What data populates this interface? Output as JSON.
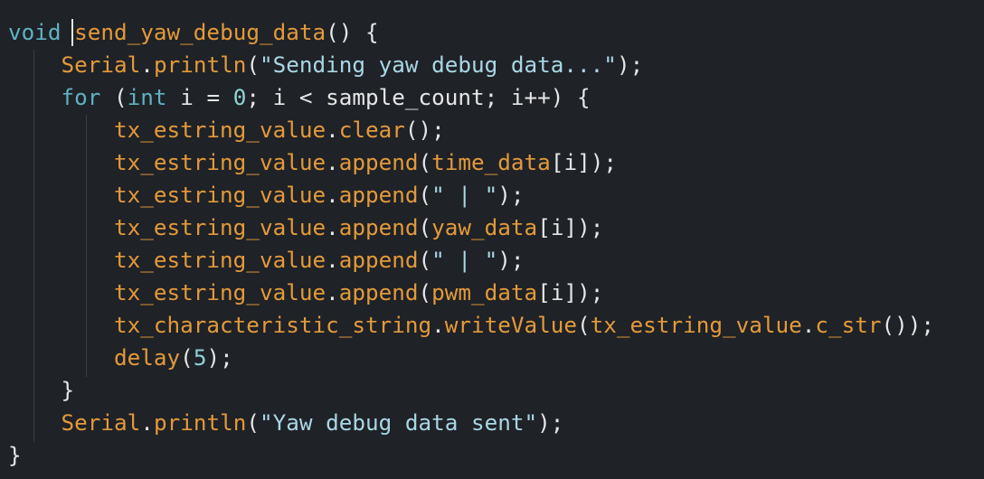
{
  "editor": {
    "lines": [
      [
        {
          "t": "void",
          "c": "kw"
        },
        {
          "t": " ",
          "c": "pun"
        },
        {
          "t": "send_yaw_debug_data",
          "c": "fn"
        },
        {
          "t": "() {",
          "c": "pun"
        }
      ],
      [
        {
          "t": "    ",
          "c": "pun"
        },
        {
          "t": "Serial",
          "c": "id"
        },
        {
          "t": ".",
          "c": "pun"
        },
        {
          "t": "println",
          "c": "fn"
        },
        {
          "t": "(",
          "c": "pun"
        },
        {
          "t": "\"Sending yaw debug data...\"",
          "c": "str"
        },
        {
          "t": ");",
          "c": "pun"
        }
      ],
      [
        {
          "t": "    ",
          "c": "pun"
        },
        {
          "t": "for",
          "c": "kw"
        },
        {
          "t": " (",
          "c": "pun"
        },
        {
          "t": "int",
          "c": "kw"
        },
        {
          "t": " i = ",
          "c": "op"
        },
        {
          "t": "0",
          "c": "num"
        },
        {
          "t": "; i < sample_count; i++) {",
          "c": "op"
        }
      ],
      [
        {
          "t": "        ",
          "c": "pun"
        },
        {
          "t": "tx_estring_value",
          "c": "id"
        },
        {
          "t": ".",
          "c": "pun"
        },
        {
          "t": "clear",
          "c": "fn"
        },
        {
          "t": "();",
          "c": "pun"
        }
      ],
      [
        {
          "t": "        ",
          "c": "pun"
        },
        {
          "t": "tx_estring_value",
          "c": "id"
        },
        {
          "t": ".",
          "c": "pun"
        },
        {
          "t": "append",
          "c": "fn"
        },
        {
          "t": "(",
          "c": "pun"
        },
        {
          "t": "time_data",
          "c": "id"
        },
        {
          "t": "[i]);",
          "c": "pun"
        }
      ],
      [
        {
          "t": "        ",
          "c": "pun"
        },
        {
          "t": "tx_estring_value",
          "c": "id"
        },
        {
          "t": ".",
          "c": "pun"
        },
        {
          "t": "append",
          "c": "fn"
        },
        {
          "t": "(",
          "c": "pun"
        },
        {
          "t": "\" | \"",
          "c": "str"
        },
        {
          "t": ");",
          "c": "pun"
        }
      ],
      [
        {
          "t": "        ",
          "c": "pun"
        },
        {
          "t": "tx_estring_value",
          "c": "id"
        },
        {
          "t": ".",
          "c": "pun"
        },
        {
          "t": "append",
          "c": "fn"
        },
        {
          "t": "(",
          "c": "pun"
        },
        {
          "t": "yaw_data",
          "c": "id"
        },
        {
          "t": "[i]);",
          "c": "pun"
        }
      ],
      [
        {
          "t": "        ",
          "c": "pun"
        },
        {
          "t": "tx_estring_value",
          "c": "id"
        },
        {
          "t": ".",
          "c": "pun"
        },
        {
          "t": "append",
          "c": "fn"
        },
        {
          "t": "(",
          "c": "pun"
        },
        {
          "t": "\" | \"",
          "c": "str"
        },
        {
          "t": ");",
          "c": "pun"
        }
      ],
      [
        {
          "t": "        ",
          "c": "pun"
        },
        {
          "t": "tx_estring_value",
          "c": "id"
        },
        {
          "t": ".",
          "c": "pun"
        },
        {
          "t": "append",
          "c": "fn"
        },
        {
          "t": "(",
          "c": "pun"
        },
        {
          "t": "pwm_data",
          "c": "id"
        },
        {
          "t": "[i]);",
          "c": "pun"
        }
      ],
      [
        {
          "t": "        ",
          "c": "pun"
        },
        {
          "t": "tx_characteristic_string",
          "c": "id"
        },
        {
          "t": ".",
          "c": "pun"
        },
        {
          "t": "writeValue",
          "c": "fn"
        },
        {
          "t": "(",
          "c": "pun"
        },
        {
          "t": "tx_estring_value",
          "c": "id"
        },
        {
          "t": ".",
          "c": "pun"
        },
        {
          "t": "c_str",
          "c": "fn"
        },
        {
          "t": "());",
          "c": "pun"
        }
      ],
      [
        {
          "t": "        ",
          "c": "pun"
        },
        {
          "t": "delay",
          "c": "fn"
        },
        {
          "t": "(",
          "c": "pun"
        },
        {
          "t": "5",
          "c": "num"
        },
        {
          "t": ");",
          "c": "pun"
        }
      ],
      [
        {
          "t": "    }",
          "c": "pun"
        }
      ],
      [
        {
          "t": "    ",
          "c": "pun"
        },
        {
          "t": "Serial",
          "c": "id"
        },
        {
          "t": ".",
          "c": "pun"
        },
        {
          "t": "println",
          "c": "fn"
        },
        {
          "t": "(",
          "c": "pun"
        },
        {
          "t": "\"Yaw debug data sent\"",
          "c": "str"
        },
        {
          "t": ");",
          "c": "pun"
        }
      ],
      [
        {
          "t": "}",
          "c": "pun"
        }
      ]
    ]
  }
}
